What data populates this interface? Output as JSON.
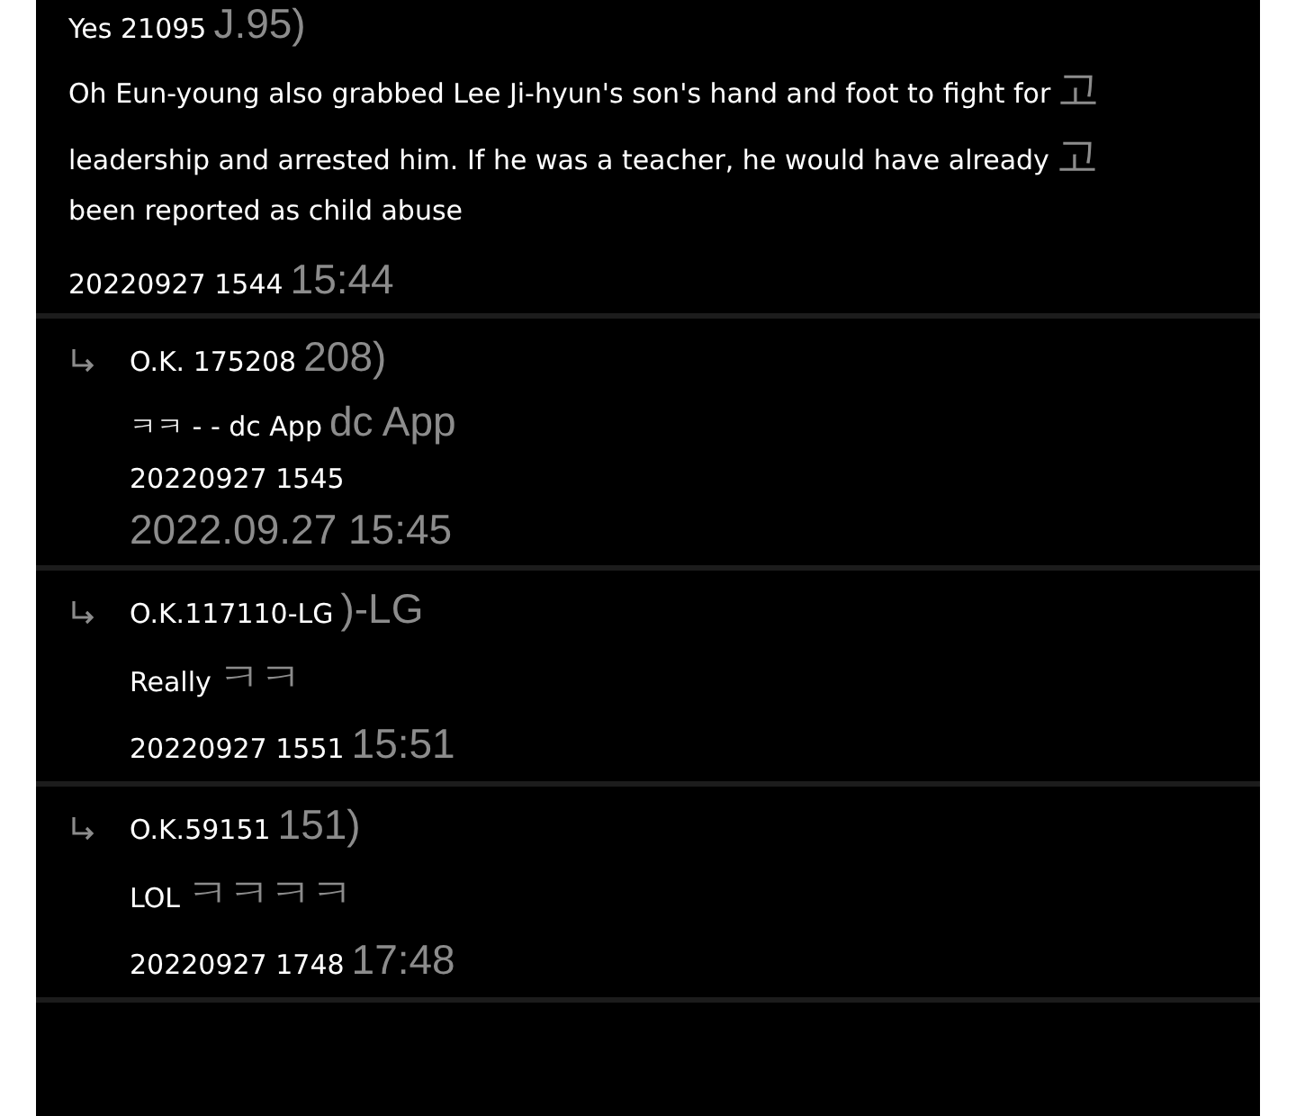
{
  "comments": [
    {
      "kind": "main",
      "author": "Yes 21095",
      "author_rest": "J.95)",
      "body": [
        {
          "text": "Oh Eun-young also grabbed Lee Ji-hyun's son's hand and foot to fight for",
          "rest": "고"
        },
        {
          "text": "leadership and arrested him. If he was a teacher, he would have already",
          "rest": "고"
        },
        {
          "text": "been reported as child abuse"
        }
      ],
      "date": "20220927 1544",
      "date_rest": "15:44"
    },
    {
      "kind": "reply",
      "author": "O.K. 175208",
      "author_rest": "208)",
      "body": [
        {
          "text": "ㅋㅋ - - dc App",
          "rest": "dc App"
        }
      ],
      "date": "20220927 1545",
      "date_note": "2022.09.27 15:45"
    },
    {
      "kind": "reply",
      "author": "O.K.117110-LG",
      "author_rest": ")-LG",
      "body": [
        {
          "text": "Really",
          "rest": "ㅋㅋ"
        }
      ],
      "date": "20220927 1551",
      "date_rest": "15:51"
    },
    {
      "kind": "reply",
      "author": "O.K.59151",
      "author_rest": "151)",
      "body": [
        {
          "text": "LOL",
          "rest": "ㅋㅋㅋㅋ"
        }
      ],
      "date": "20220927 1748",
      "date_rest": "17:48"
    }
  ]
}
